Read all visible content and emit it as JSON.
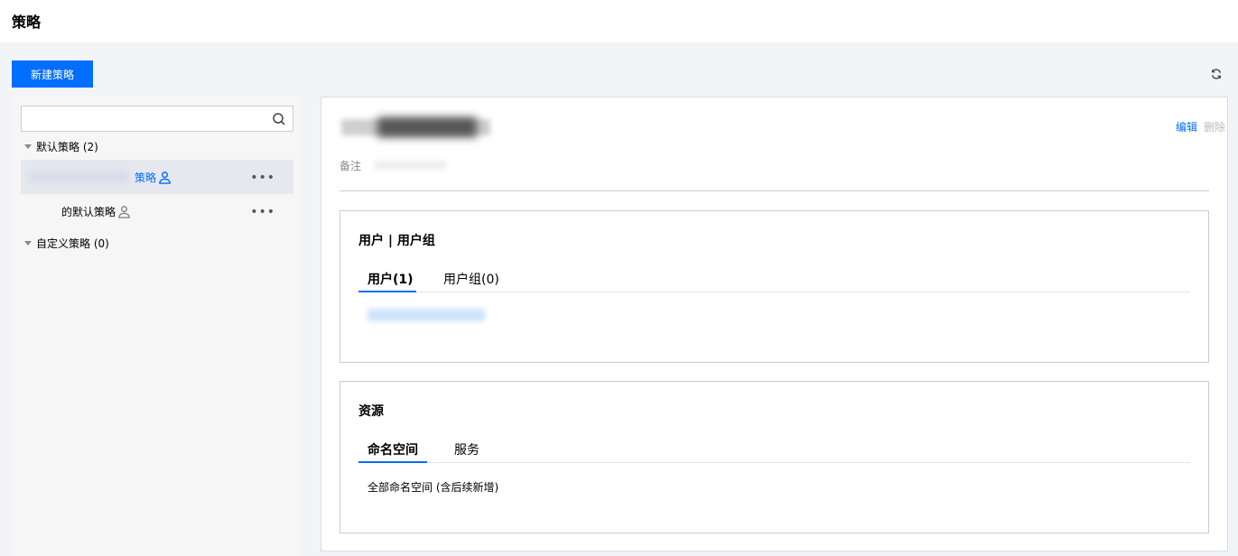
{
  "page": {
    "title": "策略"
  },
  "toolbar": {
    "new_policy_label": "新建策略"
  },
  "search": {
    "value": "",
    "placeholder": ""
  },
  "tree": {
    "groups": [
      {
        "label": "默认策略 (2)"
      },
      {
        "label": "自定义策略 (0)"
      }
    ],
    "items": [
      {
        "label": "策略",
        "more": "•••"
      },
      {
        "label": "的默认策略",
        "more": "•••"
      }
    ]
  },
  "detail": {
    "edit_label": "编辑",
    "delete_label": "删除",
    "remark_label": "备注",
    "users_section": {
      "title": "用户 | 用户组",
      "tabs": [
        {
          "label": "用户(1)"
        },
        {
          "label": "用户组(0)"
        }
      ]
    },
    "resources_section": {
      "title": "资源",
      "tabs": [
        {
          "label": "命名空间"
        },
        {
          "label": "服务"
        }
      ],
      "content": "全部命名空间 (含后续新增)"
    }
  },
  "colors": {
    "accent": "#006eff",
    "page_bg": "#f3f4f7",
    "panel_bg": "#f6f6f6"
  }
}
